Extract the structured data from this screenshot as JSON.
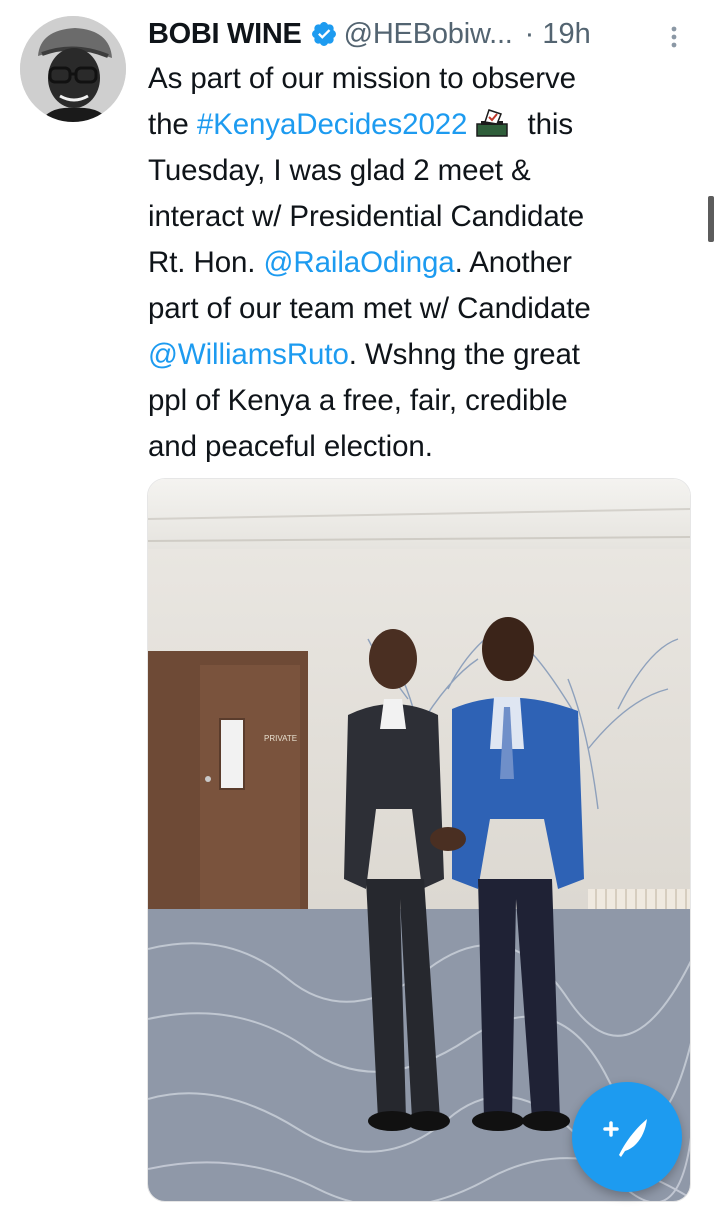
{
  "tweet": {
    "author_name": "BOBI WINE",
    "handle": "@HEBobiw...",
    "separator": "·",
    "time": "19h",
    "lines": [
      {
        "parts": [
          {
            "t": "As part of our mission to observe",
            "link": false
          }
        ]
      },
      {
        "parts": [
          {
            "t": "the ",
            "link": false
          },
          {
            "t": "#KenyaDecides2022",
            "link": true
          },
          {
            "emoji": "ballot-box-icon"
          },
          {
            "t": " this",
            "link": false
          }
        ]
      },
      {
        "parts": [
          {
            "t": "Tuesday, I was glad 2 meet &",
            "link": false
          }
        ]
      },
      {
        "parts": [
          {
            "t": "interact w/ Presidential Candidate",
            "link": false
          }
        ]
      },
      {
        "parts": [
          {
            "t": "Rt. Hon. ",
            "link": false
          },
          {
            "t": "@RailaOdinga",
            "link": true
          },
          {
            "t": ". Another",
            "link": false
          }
        ]
      },
      {
        "parts": [
          {
            "t": "part of our team met w/ Candidate",
            "link": false
          }
        ]
      },
      {
        "parts": [
          {
            "t": "@WilliamsRuto",
            "link": true
          },
          {
            "t": ". Wshng the great",
            "link": false
          }
        ]
      },
      {
        "parts": [
          {
            "t": "ppl of Kenya a free, fair, credible",
            "link": false
          }
        ]
      },
      {
        "parts": [
          {
            "t": "and peaceful election.",
            "link": false
          }
        ]
      }
    ],
    "photo_sign_text": "PRIVATE"
  },
  "icons": {
    "verified": "verified-badge-icon",
    "more": "more-vertical-icon",
    "compose": "compose-tweet-icon"
  },
  "colors": {
    "link": "#1d9bf0",
    "fab": "#1d9bf0",
    "muted": "#536471"
  }
}
